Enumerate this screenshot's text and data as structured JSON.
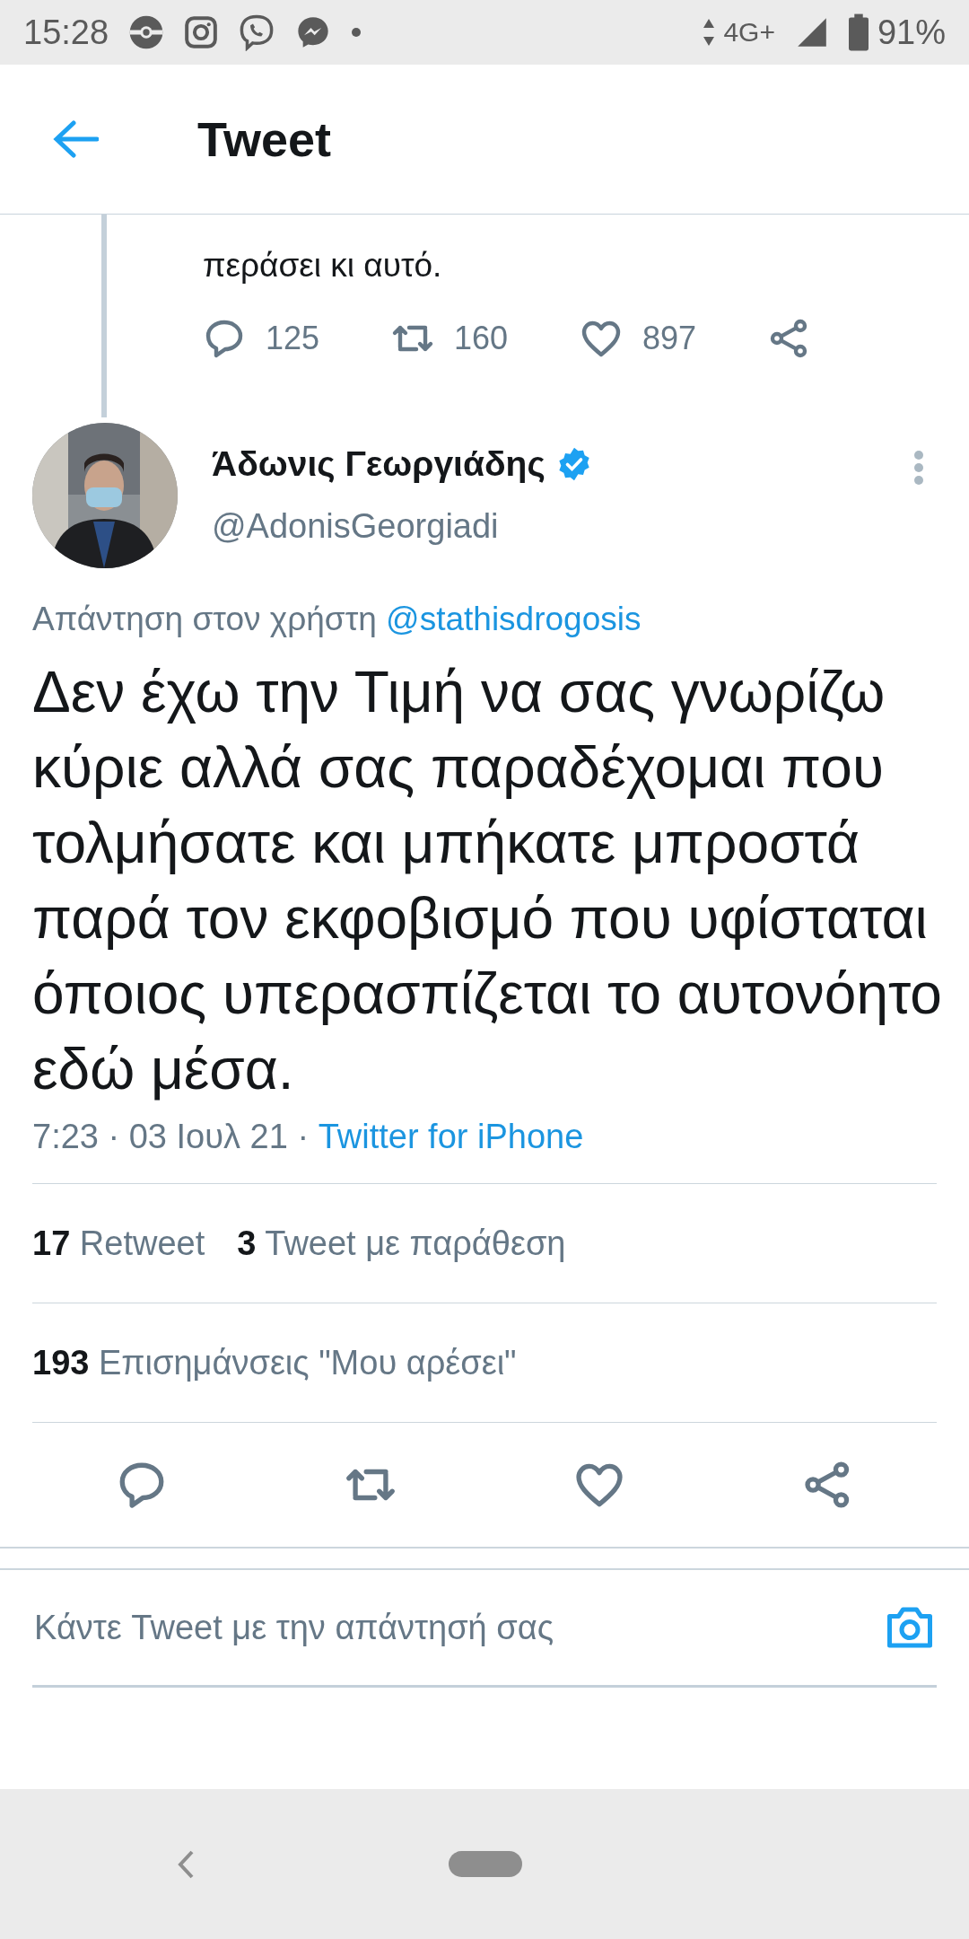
{
  "status_bar": {
    "time": "15:28",
    "network": "4G+",
    "battery": "91%"
  },
  "header": {
    "title": "Tweet"
  },
  "parent_tweet": {
    "text_end": "περάσει κι αυτό.",
    "actions": [
      {
        "kind": "reply",
        "count": "125"
      },
      {
        "kind": "retweet",
        "count": "160"
      },
      {
        "kind": "like",
        "count": "897"
      },
      {
        "kind": "share"
      }
    ]
  },
  "tweet": {
    "author": {
      "name": "Άδωνις Γεωργιάδης",
      "handle": "@AdonisGeorgiadi",
      "verified": true
    },
    "reply_to": {
      "prefix": "Απάντηση στον χρήστη",
      "handle": "@stathisdrogosis"
    },
    "text": "Δεν έχω την Τιμή να σας γνωρίζω κύριε αλλά σας παραδέχομαι που τολμήσατε και μπήκατε μπροστά παρά τον εκφοβισμό που υφίσταται όποιος υπερασπίζεται το αυτονόητο εδώ μέσα.",
    "timestamp": "7:23 · 03 Ιουλ 21 ·",
    "source": "Twitter for iPhone",
    "stats": [
      {
        "count": "17",
        "label": "Retweet"
      },
      {
        "count": "3",
        "label": "Tweet με παράθεση"
      }
    ],
    "likes": {
      "count": "193",
      "label": "Επισημάνσεις \"Μου αρέσει\""
    },
    "actions": [
      {
        "kind": "reply"
      },
      {
        "kind": "retweet"
      },
      {
        "kind": "like"
      },
      {
        "kind": "share"
      }
    ]
  },
  "compose": {
    "placeholder": "Κάντε Tweet με την απάντησή σας"
  }
}
